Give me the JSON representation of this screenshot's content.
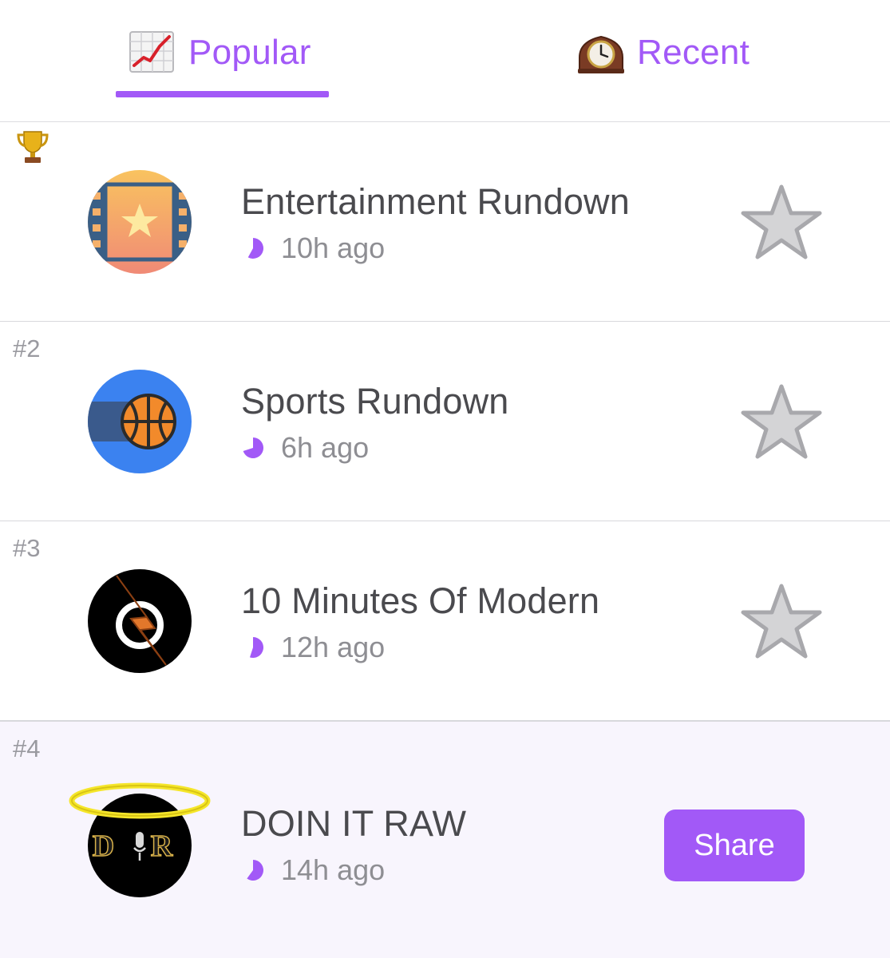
{
  "tabs": {
    "popular": {
      "label": "Popular",
      "icon": "chart-increasing-icon",
      "active": true
    },
    "recent": {
      "label": "Recent",
      "icon": "mantelpiece-clock-icon",
      "active": false
    }
  },
  "accent_color": "#a259f7",
  "rows": [
    {
      "rank": "",
      "rank_icon": "trophy-icon",
      "title": "Entertainment Rundown",
      "time": "10h ago",
      "progress": 0.58,
      "action": "star",
      "avatar": "film-star-avatar"
    },
    {
      "rank": "#2",
      "title": "Sports Rundown",
      "time": "6h ago",
      "progress": 0.7,
      "action": "star",
      "avatar": "basketball-avatar"
    },
    {
      "rank": "#3",
      "title": "10 Minutes Of Modern",
      "time": "12h ago",
      "progress": 0.55,
      "action": "star",
      "avatar": "lightning-avatar"
    },
    {
      "rank": "#4",
      "title": "DOIN IT RAW",
      "time": "14h ago",
      "progress": 0.6,
      "action": "share",
      "action_label": "Share",
      "avatar": "dir-logo-avatar",
      "avatar_text": "D R",
      "highlighted": true
    }
  ]
}
